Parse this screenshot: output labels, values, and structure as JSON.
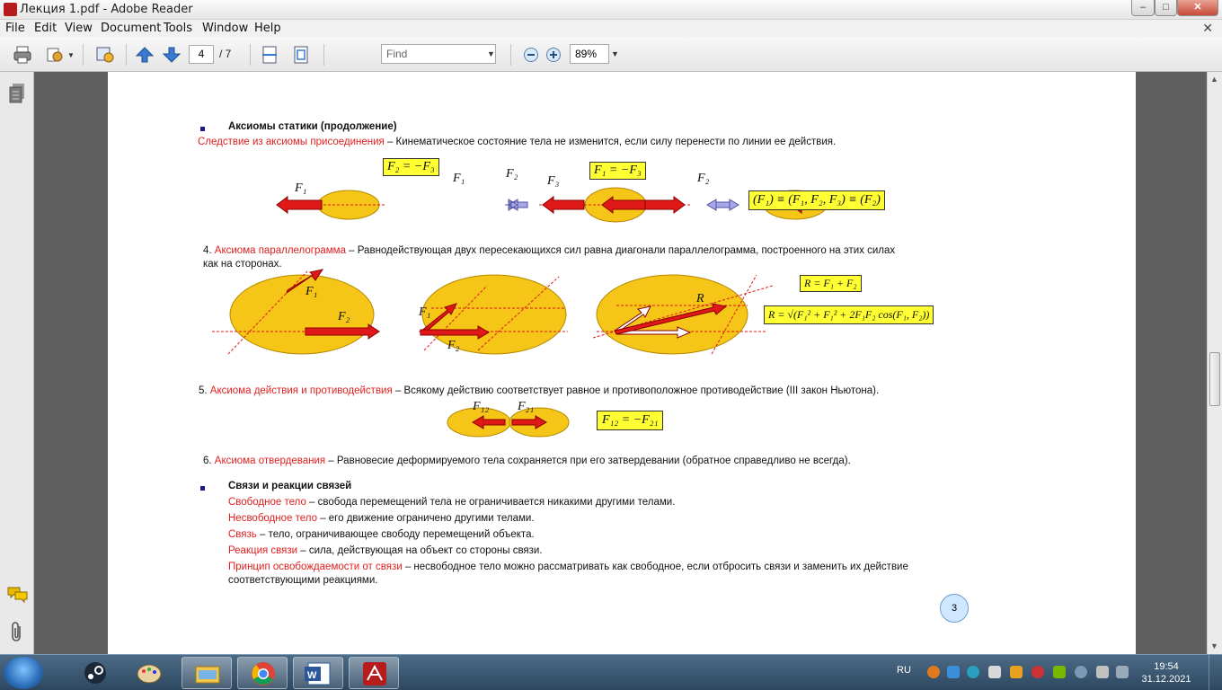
{
  "window": {
    "title": "Лекция 1.pdf - Adobe Reader",
    "minimize": "–",
    "maximize": "□",
    "close": "✕"
  },
  "menu": {
    "items": [
      "File",
      "Edit",
      "View",
      "Document",
      "Tools",
      "Window",
      "Help"
    ],
    "close": "✕"
  },
  "toolbar": {
    "page_current": "4",
    "page_total": "/  7",
    "find_placeholder": "Find",
    "zoom": "89%"
  },
  "document": {
    "h1": "Аксиомы статики (продолжение)",
    "corollary_label": "Следствие из аксиомы присоединения",
    "corollary_text": " – Кинематическое  состояние тела не  изменится,  если силу перенести  по линии  ее действия.",
    "eq1": "F₂ = −F₃",
    "eq2": "F₁ = −F₃",
    "eq3": "(F₁) ≡ (F₁, F₂, F₃) ≡ (F₂)",
    "f_labels": [
      "F₁",
      "F₁",
      "F₂",
      "F₃",
      "F₂"
    ],
    "ax4_num": "4. ",
    "ax4_label": "Аксиома параллелограмма",
    "ax4_text": " – Равнодействующая двух пересекающихся сил равна диагонали параллелограмма, построенного на этих силах",
    "ax4_text2": "как на сторонах.",
    "para_labels": [
      "F₁",
      "F₂",
      "F₁",
      "F₂",
      "R"
    ],
    "eq_r": "R = F₁ + F₂",
    "eq_r2": "R = √(F₁² + F₁² + 2F₁F₂ cos(F₁, F₂))",
    "ax5_num": "5. ",
    "ax5_label": "Аксиома действия  и противодействия",
    "ax5_text": " – Всякому действию соответствует равное и противоположное противодействие (III  закон Ньютона).",
    "f12": "F₁₂",
    "f21": "F₂₁",
    "eq_f12": "F₁₂  = −F₂₁",
    "ax6_num": "6. ",
    "ax6_label": "Аксиома отвердевания",
    "ax6_text": " – Равновесие деформируемого тела сохраняется при его затвердевании  (обратное справедливо не  всегда).",
    "h2": "Связи и реакции связей",
    "d1_label": "Свободное тело",
    "d1_text": " – свобода перемещений тела не  ограничивается никакими  другими телами.",
    "d2_label": "Несвободное тело",
    "d2_text": " – его движение  ограничено другими телами.",
    "d3_label": "Связь",
    "d3_text": "  – тело, ограничивающее  свободу перемещений  объекта.",
    "d4_label": "Реакция связи",
    "d4_text": "  – сила, действующая на объект со стороны связи.",
    "d5_label": "Принцип освобождаемости от связи",
    "d5_text": " – несвободное тело можно рассматривать как свободное, если отбросить связи и заменить  их действие",
    "d5_text2": "соответствующими реакциями.",
    "page_number": "3"
  },
  "taskbar": {
    "lang": "RU",
    "time": "19:54",
    "date": "31.12.2021"
  },
  "colors": {
    "accent_red": "#e02020",
    "ellipse_fill": "#f5c518",
    "arrow_red": "#e01818",
    "eq_box": "#ffff33"
  }
}
